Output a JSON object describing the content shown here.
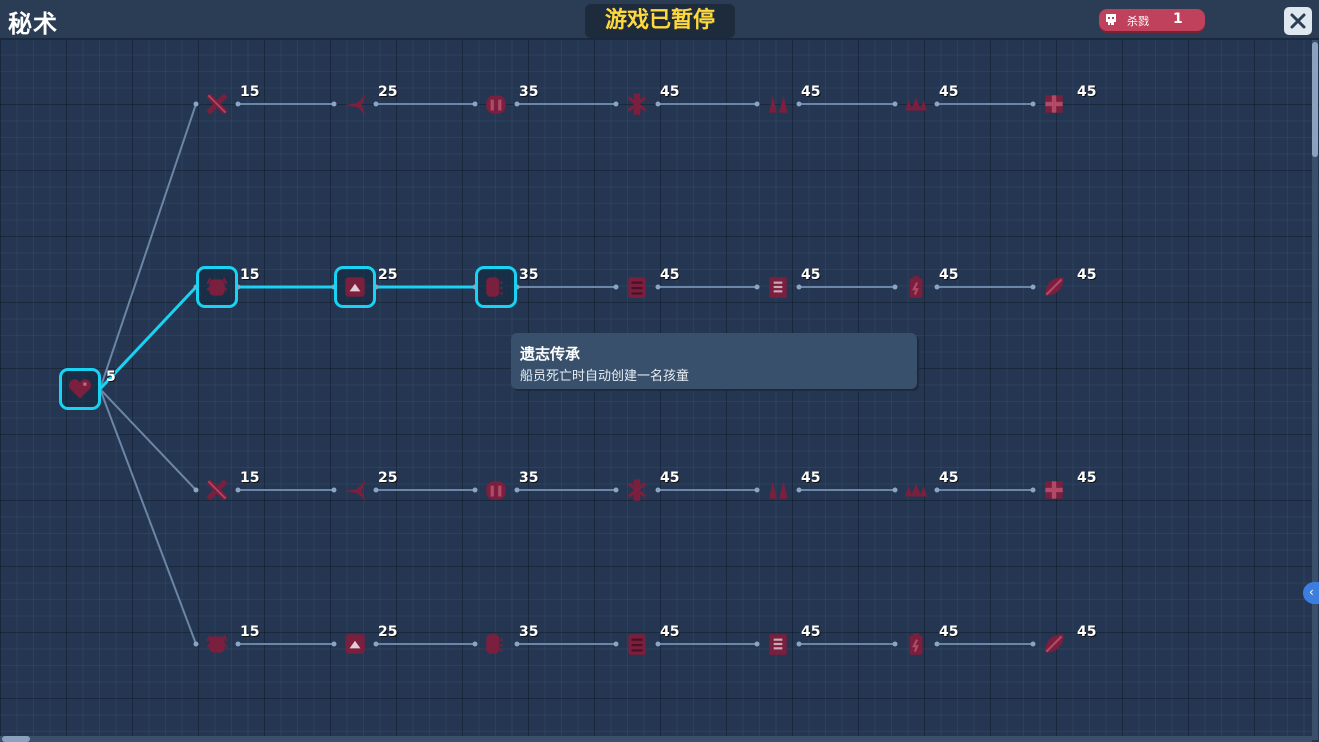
{
  "header": {
    "title": "秘术",
    "paused_label": "游戏已暂停",
    "kills_label": "杀戮",
    "kills_value": "1",
    "close_icon": "close-icon",
    "skull_icon": "skull-icon"
  },
  "colors": {
    "selected_border": "#19d3f3",
    "line": "#6b86a6",
    "icon": "#7a1f3d",
    "paused_text": "#ffd93b",
    "kill_badge": "#c0415c"
  },
  "tooltip": {
    "title": "遗志传承",
    "description": "船员死亡时自动创建一名孩童"
  },
  "tree": {
    "root": {
      "icon": "heart-icon",
      "cost": "5",
      "selected": true
    },
    "rows": [
      [
        {
          "icon": "crossed-swords-icon",
          "cost": "15",
          "selected": false
        },
        {
          "icon": "arrow-hit-icon",
          "cost": "25",
          "selected": false
        },
        {
          "icon": "shield-helmet-icon",
          "cost": "35",
          "selected": false
        },
        {
          "icon": "thorn-bug-icon",
          "cost": "45",
          "selected": false
        },
        {
          "icon": "fangs-icon",
          "cost": "45",
          "selected": false
        },
        {
          "icon": "spikes-icon",
          "cost": "45",
          "selected": false
        },
        {
          "icon": "cross-shield-icon",
          "cost": "45",
          "selected": false
        }
      ],
      [
        {
          "icon": "crab-shell-icon",
          "cost": "15",
          "selected": true
        },
        {
          "icon": "house-badge-icon",
          "cost": "25",
          "selected": true
        },
        {
          "icon": "cocoon-icon",
          "cost": "35",
          "selected": true
        },
        {
          "icon": "book-icon",
          "cost": "45",
          "selected": false
        },
        {
          "icon": "scroll-page-icon",
          "cost": "45",
          "selected": false
        },
        {
          "icon": "battery-icon",
          "cost": "45",
          "selected": false
        },
        {
          "icon": "feather-leaf-icon",
          "cost": "45",
          "selected": false
        }
      ],
      [
        {
          "icon": "flexed-arm-icon",
          "cost": "15",
          "selected": false
        },
        {
          "icon": "wrench-icon",
          "cost": "25",
          "selected": false
        },
        {
          "icon": "sun-compass-icon",
          "cost": "35",
          "selected": false
        },
        {
          "icon": "hammer-icon",
          "cost": "45",
          "selected": false
        },
        {
          "icon": "fish-bag-icon",
          "cost": "45",
          "selected": false
        },
        {
          "icon": "flag-icon",
          "cost": "45",
          "selected": false
        },
        {
          "icon": "treasure-chest-icon",
          "cost": "45",
          "selected": false
        }
      ],
      [
        {
          "icon": "ham-icon",
          "cost": "15",
          "selected": false
        },
        {
          "icon": "grass-blade-icon",
          "cost": "25",
          "selected": false
        },
        {
          "icon": "apple-icon",
          "cost": "35",
          "selected": false
        },
        {
          "icon": "meat-chunk-icon",
          "cost": "45",
          "selected": false
        },
        {
          "icon": "sparkle-fish-icon",
          "cost": "45",
          "selected": false
        },
        {
          "icon": "bug-totem-icon",
          "cost": "45",
          "selected": false
        },
        {
          "icon": "cauldron-icon",
          "cost": "45",
          "selected": false
        }
      ]
    ]
  }
}
